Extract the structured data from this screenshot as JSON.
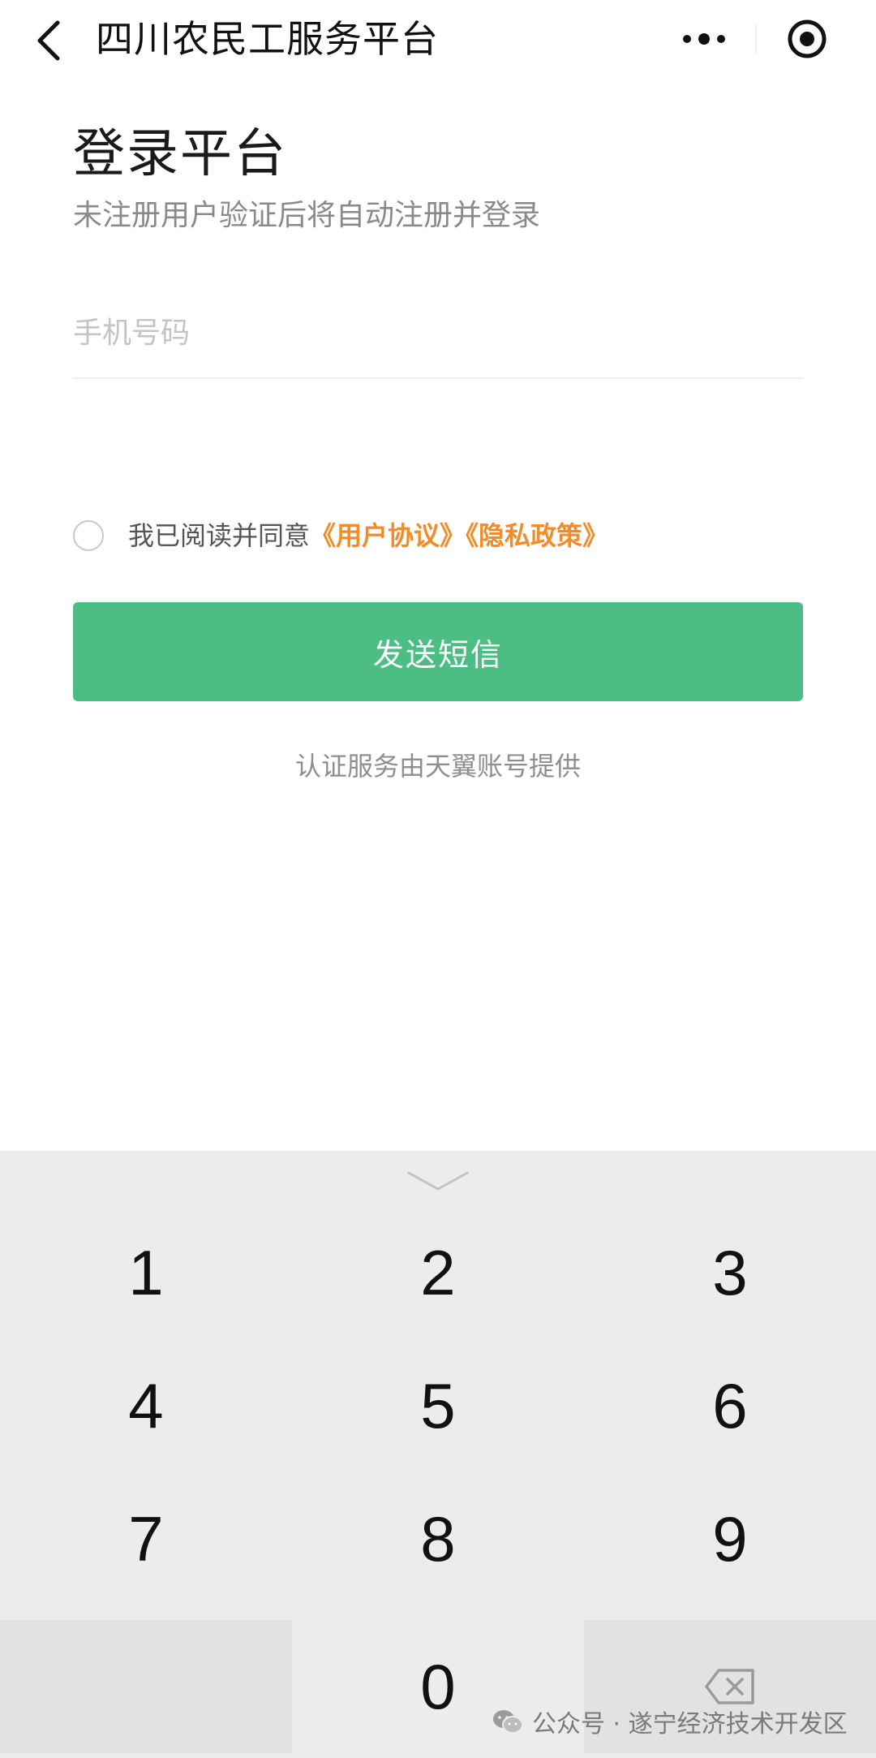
{
  "nav": {
    "title": "四川农民工服务平台"
  },
  "login": {
    "title": "登录平台",
    "subtitle": "未注册用户验证后将自动注册并登录",
    "phone_placeholder": "手机号码",
    "agreement_prefix": "我已阅读并同意",
    "user_agreement": "《用户协议》",
    "privacy_policy": "《隐私政策》",
    "send_sms_label": "发送短信",
    "auth_provider": "认证服务由天翼账号提供"
  },
  "keyboard": {
    "keys": [
      "1",
      "2",
      "3",
      "4",
      "5",
      "6",
      "7",
      "8",
      "9",
      "0"
    ]
  },
  "watermark": {
    "text": "公众号 · 遂宁经济技术开发区"
  },
  "colors": {
    "primary_button": "#4cbe83",
    "link": "#f28c28",
    "keyboard_bg": "#ececec"
  }
}
